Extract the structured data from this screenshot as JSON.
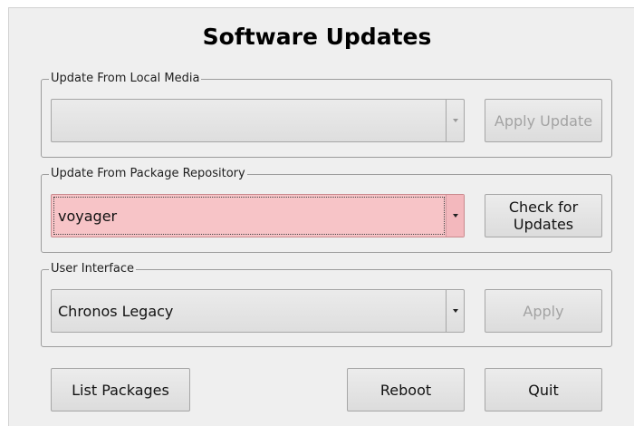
{
  "title": "Software Updates",
  "local_media": {
    "legend": "Update From Local Media",
    "selected": "",
    "apply_label": "Apply Update"
  },
  "repository": {
    "legend": "Update From Package Repository",
    "selected": "voyager",
    "check_label": "Check for Updates"
  },
  "user_interface": {
    "legend": "User Interface",
    "selected": "Chronos Legacy",
    "apply_label": "Apply"
  },
  "footer": {
    "list_packages_label": "List Packages",
    "reboot_label": "Reboot",
    "quit_label": "Quit"
  },
  "colors": {
    "highlight_field": "#f7c4c7",
    "window_bg": "#efefef"
  },
  "icons": {
    "dropdown": "chevron-down-icon"
  }
}
